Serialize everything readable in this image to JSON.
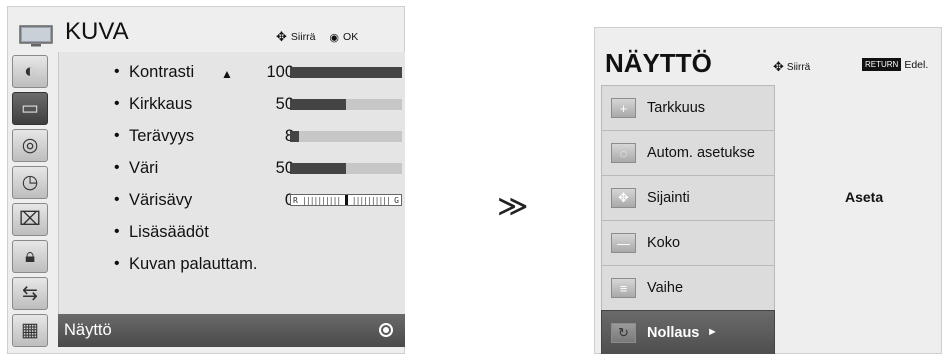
{
  "left_menu": {
    "title": "KUVA",
    "hint_move": "Siirrä",
    "hint_ok": "OK",
    "tabs": [
      {
        "icon": "picture-tab-icon",
        "glyph": "◐"
      },
      {
        "icon": "tv-tab-icon",
        "glyph": "▭",
        "active": true
      },
      {
        "icon": "audio-tab-icon",
        "glyph": "◎"
      },
      {
        "icon": "time-tab-icon",
        "glyph": "◷"
      },
      {
        "icon": "option-tab-icon",
        "glyph": "⌧"
      },
      {
        "icon": "lock-tab-icon",
        "glyph": "🔒︎"
      },
      {
        "icon": "input-tab-icon",
        "glyph": "⇆"
      },
      {
        "icon": "usb-tab-icon",
        "glyph": "▦"
      }
    ],
    "items": [
      {
        "label": "Kontrasti",
        "value": "100",
        "level": 100
      },
      {
        "label": "Kirkkaus",
        "value": "50",
        "level": 50
      },
      {
        "label": "Terävyys",
        "value": "8",
        "level": 8
      },
      {
        "label": "Väri",
        "value": "50",
        "level": 50
      },
      {
        "label": "Värisävy",
        "value": "0",
        "tint_left": "R",
        "tint_right": "G"
      },
      {
        "label": "Lisäsäädöt"
      },
      {
        "label": "Kuvan palauttam."
      }
    ],
    "selected": "Näyttö"
  },
  "arrow": "≫",
  "right_menu": {
    "title": "NÄYTTÖ",
    "hint_move": "Siirrä",
    "return_key": "RETURN",
    "hint_back": "Edel.",
    "options": [
      {
        "label": "Tarkkuus",
        "glyph": "+"
      },
      {
        "label": "Autom. asetukse",
        "glyph": "◌"
      },
      {
        "label": "Sijainti",
        "glyph": "✥"
      },
      {
        "label": "Koko",
        "glyph": "—"
      },
      {
        "label": "Vaihe",
        "glyph": "≡"
      },
      {
        "label": "Nollaus",
        "glyph": "↻",
        "active": true
      }
    ],
    "aseta_label": "Aseta"
  },
  "colors": {
    "panel_bg": "#eeeeee",
    "selected_bg": "#555555",
    "bar_fill": "#444444",
    "bar_bg": "#c7c7c7"
  }
}
